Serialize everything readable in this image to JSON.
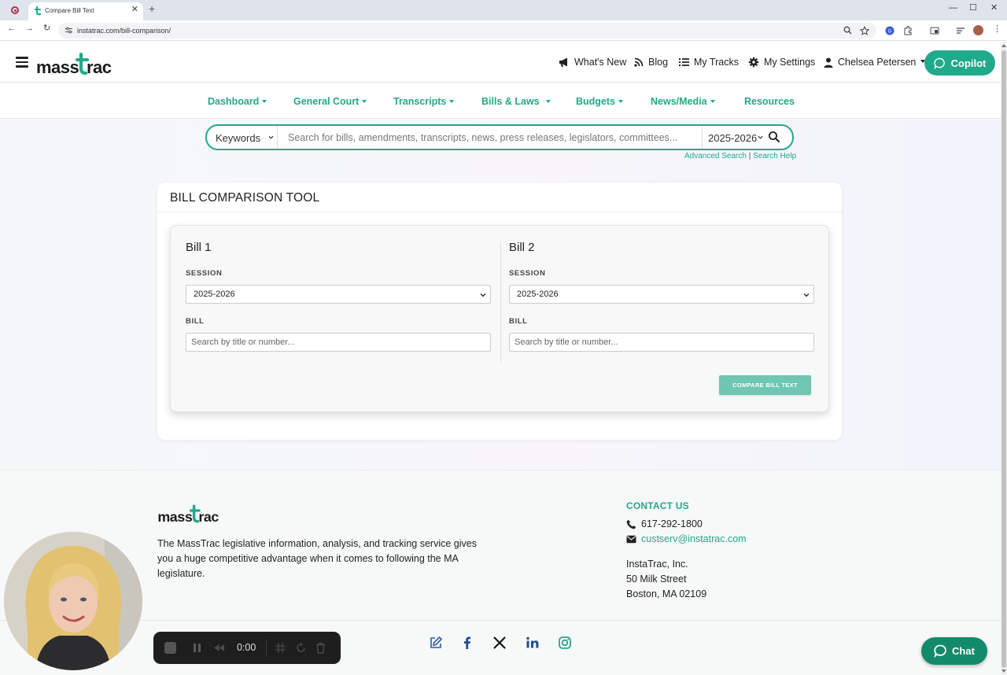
{
  "browser": {
    "tab_title": "Compare Bill Text",
    "url": "instatrac.com/bill-comparison/"
  },
  "header": {
    "logo_text": "masstrac",
    "links": [
      {
        "label": "What's New",
        "icon": "megaphone-icon"
      },
      {
        "label": "Blog",
        "icon": "rss-icon"
      },
      {
        "label": "My Tracks",
        "icon": "list-icon"
      },
      {
        "label": "My Settings",
        "icon": "gear-icon"
      },
      {
        "label": "Chelsea Petersen",
        "icon": "user-icon"
      }
    ],
    "copilot_label": "Copilot"
  },
  "nav": {
    "items": [
      {
        "label": "Dashboard",
        "has_dropdown": true
      },
      {
        "label": "General Court",
        "has_dropdown": true
      },
      {
        "label": "Transcripts",
        "has_dropdown": true
      },
      {
        "label": "Bills & Laws",
        "has_dropdown": true
      },
      {
        "label": "Budgets",
        "has_dropdown": true
      },
      {
        "label": "News/Media",
        "has_dropdown": true
      },
      {
        "label": "Resources",
        "has_dropdown": false
      }
    ]
  },
  "search": {
    "type_value": "Keywords",
    "placeholder": "Search for bills, amendments, transcripts, news, press releases, legislators, committees...",
    "session_value": "2025-2026",
    "advanced_label": "Advanced Search",
    "separator": "|",
    "help_label": "Search Help"
  },
  "tool": {
    "title": "BILL COMPARISON TOOL",
    "bill1": {
      "heading": "Bill 1",
      "session_label": "SESSION",
      "session_value": "2025-2026",
      "bill_label": "BILL",
      "bill_placeholder": "Search by title or number..."
    },
    "bill2": {
      "heading": "Bill 2",
      "session_label": "SESSION",
      "session_value": "2025-2026",
      "bill_label": "BILL",
      "bill_placeholder": "Search by title or number..."
    },
    "compare_label": "COMPARE BILL TEXT"
  },
  "footer": {
    "description": "The MassTrac legislative information, analysis, and tracking service gives you a huge competitive advantage when it comes to following the MA legislature.",
    "contact_heading": "CONTACT US",
    "phone": "617-292-1800",
    "email": "custserv@instatrac.com",
    "address": [
      "InstaTrac, Inc.",
      "50 Milk Street",
      "Boston, MA 02109"
    ],
    "social": [
      "edit-icon",
      "facebook-icon",
      "x-icon",
      "linkedin-icon",
      "instagram-icon"
    ]
  },
  "chat": {
    "label": "Chat"
  },
  "recorder": {
    "time": "0:00"
  },
  "colors": {
    "accent": "#21a98b",
    "chat_bg": "#138a6a",
    "button_muted": "#6fc6b2"
  }
}
